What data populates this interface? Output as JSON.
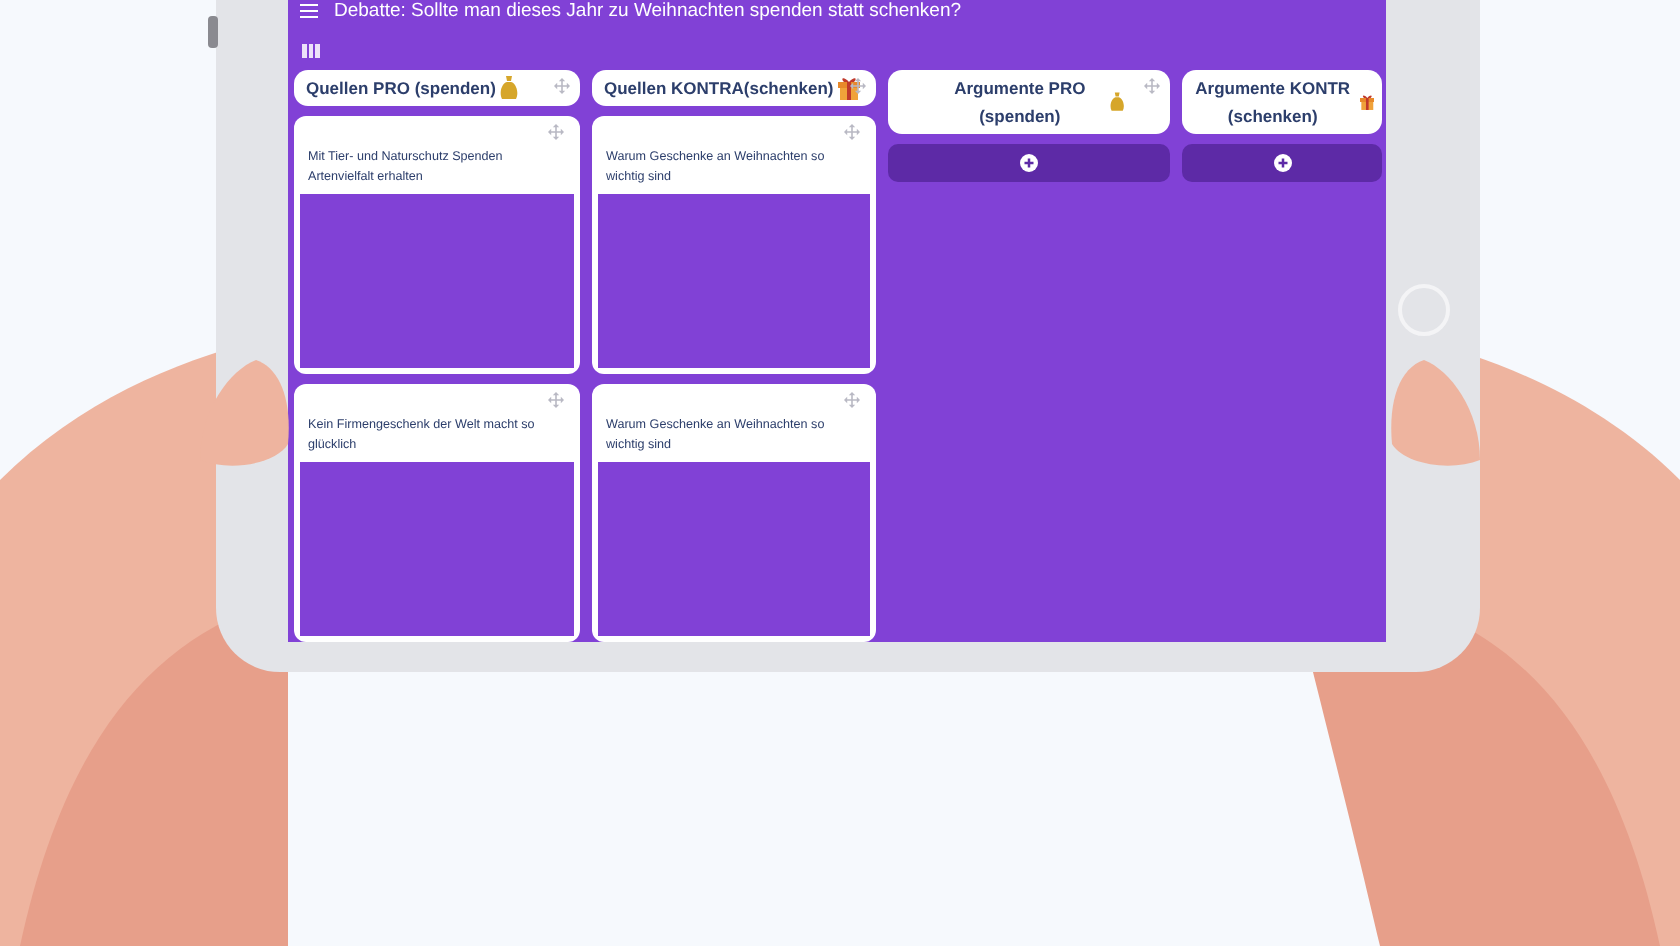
{
  "header": {
    "title": "Debatte: Sollte man dieses Jahr zu Weihnachten spenden statt schenken?"
  },
  "columns": [
    {
      "title": "Quellen PRO (spenden)",
      "kind": "pro",
      "cards": [
        {
          "text": "Mit Tier- und Naturschutz Spenden Artenvielfalt erhalten"
        },
        {
          "text": "Kein Firmengeschenk der Welt macht so glücklich"
        }
      ]
    },
    {
      "title": "Quellen KONTRA(schenken)",
      "kind": "contra",
      "cards": [
        {
          "text": "Warum Geschenke an Weihnachten so wichtig sind"
        },
        {
          "text": "Warum Geschenke an Weihnachten so wichtig sind"
        }
      ]
    },
    {
      "title": "Argumente PRO (spenden)",
      "kind": "pro",
      "add_button": true
    },
    {
      "title": "Argumente KONTR (schenken)",
      "kind": "contra",
      "add_button": true
    }
  ]
}
